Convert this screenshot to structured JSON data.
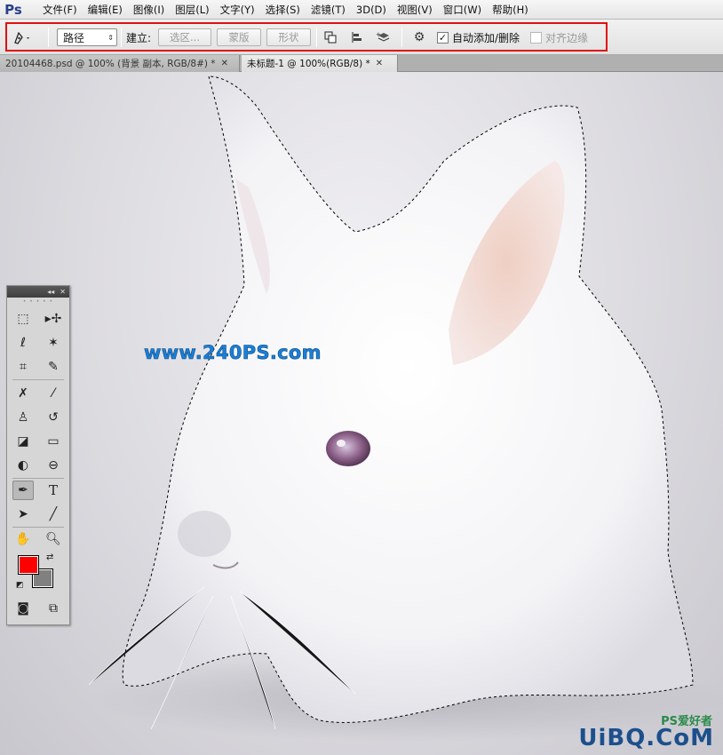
{
  "app": {
    "logo": "Ps"
  },
  "menu": [
    "文件(F)",
    "编辑(E)",
    "图像(I)",
    "图层(L)",
    "文字(Y)",
    "选择(S)",
    "滤镜(T)",
    "3D(D)",
    "视图(V)",
    "窗口(W)",
    "帮助(H)"
  ],
  "options_bar": {
    "mode_value": "路径",
    "create_label": "建立:",
    "selection_btn": "选区...",
    "mask_btn": "蒙版",
    "shape_btn": "形状",
    "auto_add_delete": {
      "label": "自动添加/删除",
      "checked": true
    },
    "align_edges": {
      "label": "对齐边缘",
      "checked": false,
      "enabled": false
    }
  },
  "tabs": [
    {
      "label": "20104468.psd @ 100% (背景 副本, RGB/8#) *",
      "active": false
    },
    {
      "label": "未标题-1 @ 100%(RGB/8) *",
      "active": true
    }
  ],
  "canvas": {
    "watermark": "www.240PS.com",
    "corner_watermark": "UiBQ.CoM",
    "corner_watermark_small": "PS爱好者"
  },
  "tools_panel": {
    "foreground_color": "#ff0000",
    "background_color": "#808080",
    "active_tool": "pen-tool"
  }
}
